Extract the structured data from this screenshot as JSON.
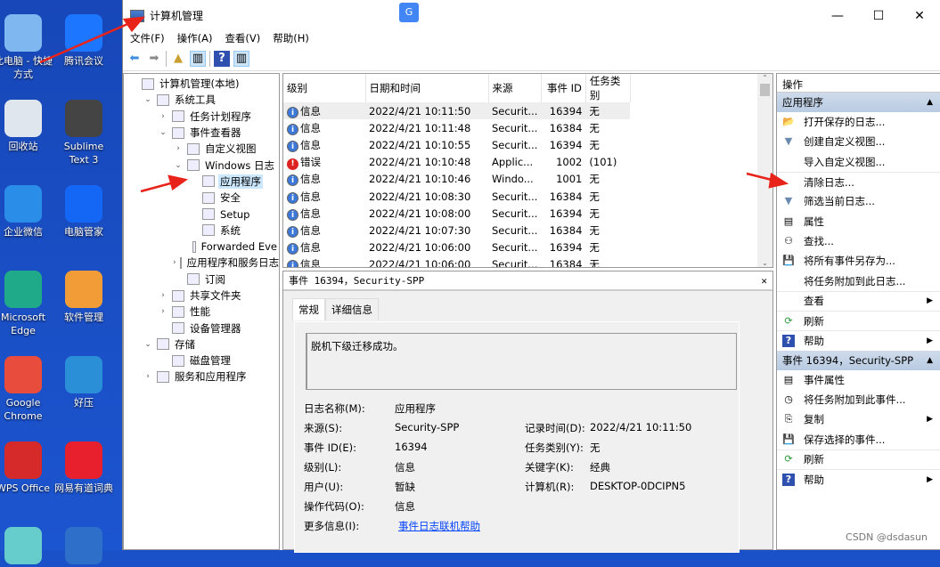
{
  "desktop": {
    "icons": [
      {
        "label": "此电脑 - 快捷方式",
        "color": "#7fb8f0"
      },
      {
        "label": "腾讯会议",
        "color": "#1d76ff"
      },
      {
        "label": "回收站",
        "color": "#dfe6ee"
      },
      {
        "label": "Sublime Text 3",
        "color": "#444"
      },
      {
        "label": "企业微信",
        "color": "#2a8ee8"
      },
      {
        "label": "电脑管家",
        "color": "#1467f5"
      },
      {
        "label": "Microsoft Edge",
        "color": "#1faa8a"
      },
      {
        "label": "软件管理",
        "color": "#f29c38"
      },
      {
        "label": "Google Chrome",
        "color": "#e74c3c"
      },
      {
        "label": "好压",
        "color": "#2b8fd8"
      },
      {
        "label": "WPS Office",
        "color": "#d62a2a"
      },
      {
        "label": "网易有道词典",
        "color": "#e8202d"
      },
      {
        "label": "",
        "color": "#6cc"
      },
      {
        "label": "",
        "color": "#2d6fc9"
      }
    ]
  },
  "window": {
    "title": "计算机管理",
    "minimize": "—",
    "maximize": "☐",
    "close": "✕"
  },
  "menu": [
    "文件(F)",
    "操作(A)",
    "查看(V)",
    "帮助(H)"
  ],
  "tree": [
    {
      "label": "计算机管理(本地)",
      "expander": "",
      "indent": 0
    },
    {
      "label": "系统工具",
      "expander": "⌄",
      "indent": 1
    },
    {
      "label": "任务计划程序",
      "expander": "›",
      "indent": 2
    },
    {
      "label": "事件查看器",
      "expander": "⌄",
      "indent": 2
    },
    {
      "label": "自定义视图",
      "expander": "›",
      "indent": 3
    },
    {
      "label": "Windows 日志",
      "expander": "⌄",
      "indent": 3
    },
    {
      "label": "应用程序",
      "expander": "",
      "indent": 4,
      "selected": true
    },
    {
      "label": "安全",
      "expander": "",
      "indent": 4
    },
    {
      "label": "Setup",
      "expander": "",
      "indent": 4
    },
    {
      "label": "系统",
      "expander": "",
      "indent": 4
    },
    {
      "label": "Forwarded Eve",
      "expander": "",
      "indent": 4
    },
    {
      "label": "应用程序和服务日志",
      "expander": "›",
      "indent": 3
    },
    {
      "label": "订阅",
      "expander": "",
      "indent": 3
    },
    {
      "label": "共享文件夹",
      "expander": "›",
      "indent": 2
    },
    {
      "label": "性能",
      "expander": "›",
      "indent": 2
    },
    {
      "label": "设备管理器",
      "expander": "",
      "indent": 2
    },
    {
      "label": "存储",
      "expander": "⌄",
      "indent": 1
    },
    {
      "label": "磁盘管理",
      "expander": "",
      "indent": 2
    },
    {
      "label": "服务和应用程序",
      "expander": "›",
      "indent": 1
    }
  ],
  "events": {
    "columns": [
      "级别",
      "日期和时间",
      "来源",
      "事件 ID",
      "任务类别"
    ],
    "rows": [
      {
        "level": "信息",
        "type": "info",
        "time": "2022/4/21 10:11:50",
        "source": "Securit...",
        "id": "16394",
        "cat": "无"
      },
      {
        "level": "信息",
        "type": "info",
        "time": "2022/4/21 10:11:48",
        "source": "Securit...",
        "id": "16384",
        "cat": "无"
      },
      {
        "level": "信息",
        "type": "info",
        "time": "2022/4/21 10:10:55",
        "source": "Securit...",
        "id": "16394",
        "cat": "无"
      },
      {
        "level": "错误",
        "type": "err",
        "time": "2022/4/21 10:10:48",
        "source": "Applic...",
        "id": "1002",
        "cat": "(101)"
      },
      {
        "level": "信息",
        "type": "info",
        "time": "2022/4/21 10:10:46",
        "source": "Windo...",
        "id": "1001",
        "cat": "无"
      },
      {
        "level": "信息",
        "type": "info",
        "time": "2022/4/21 10:08:30",
        "source": "Securit...",
        "id": "16384",
        "cat": "无"
      },
      {
        "level": "信息",
        "type": "info",
        "time": "2022/4/21 10:08:00",
        "source": "Securit...",
        "id": "16394",
        "cat": "无"
      },
      {
        "level": "信息",
        "type": "info",
        "time": "2022/4/21 10:07:30",
        "source": "Securit...",
        "id": "16384",
        "cat": "无"
      },
      {
        "level": "信息",
        "type": "info",
        "time": "2022/4/21 10:06:00",
        "source": "Securit...",
        "id": "16394",
        "cat": "无"
      },
      {
        "level": "信息",
        "type": "info",
        "time": "2022/4/21 10:06:00",
        "source": "Securit...",
        "id": "16384",
        "cat": "无"
      }
    ]
  },
  "detail": {
    "title": "事件 16394，Security-SPP",
    "close": "✕",
    "tabs": [
      "常规",
      "详细信息"
    ],
    "message": "脱机下级迁移成功。",
    "fields": {
      "log_name_label": "日志名称(M):",
      "log_name": "应用程序",
      "source_label": "来源(S):",
      "source": "Security-SPP",
      "logged_label": "记录时间(D):",
      "logged": "2022/4/21 10:11:50",
      "id_label": "事件 ID(E):",
      "id": "16394",
      "category_label": "任务类别(Y):",
      "category": "无",
      "level_label": "级别(L):",
      "level": "信息",
      "keywords_label": "关键字(K):",
      "keywords": "经典",
      "user_label": "用户(U):",
      "user": "暂缺",
      "computer_label": "计算机(R):",
      "computer": "DESKTOP-0DCIPN5",
      "opcode_label": "操作代码(O):",
      "opcode": "信息",
      "more_label": "更多信息(I):",
      "more_link": "事件日志联机帮助"
    }
  },
  "actions": {
    "header": "操作",
    "sections": [
      {
        "title": "应用程序",
        "items": [
          {
            "label": "打开保存的日志...",
            "icon": "📂"
          },
          {
            "label": "创建自定义视图...",
            "icon": "▼"
          },
          {
            "label": "导入自定义视图...",
            "icon": ""
          },
          {
            "label": "清除日志...",
            "icon": "",
            "div": true
          },
          {
            "label": "筛选当前日志...",
            "icon": "▼"
          },
          {
            "label": "属性",
            "icon": "▤"
          },
          {
            "label": "查找...",
            "icon": "⚇"
          },
          {
            "label": "将所有事件另存为...",
            "icon": "💾"
          },
          {
            "label": "将任务附加到此日志...",
            "icon": ""
          },
          {
            "label": "查看",
            "icon": "",
            "arrow": true,
            "div": true
          },
          {
            "label": "刷新",
            "icon": "⟳",
            "div": true
          },
          {
            "label": "帮助",
            "icon": "?",
            "arrow": true,
            "div": true
          }
        ]
      },
      {
        "title": "事件 16394，Security-SPP",
        "items": [
          {
            "label": "事件属性",
            "icon": "▤"
          },
          {
            "label": "将任务附加到此事件...",
            "icon": "◷"
          },
          {
            "label": "复制",
            "icon": "⎘",
            "arrow": true
          },
          {
            "label": "保存选择的事件...",
            "icon": "💾"
          },
          {
            "label": "刷新",
            "icon": "⟳",
            "div": true
          },
          {
            "label": "帮助",
            "icon": "?",
            "arrow": true,
            "div": true
          }
        ]
      }
    ]
  },
  "watermark": "CSDN @dsdasun"
}
